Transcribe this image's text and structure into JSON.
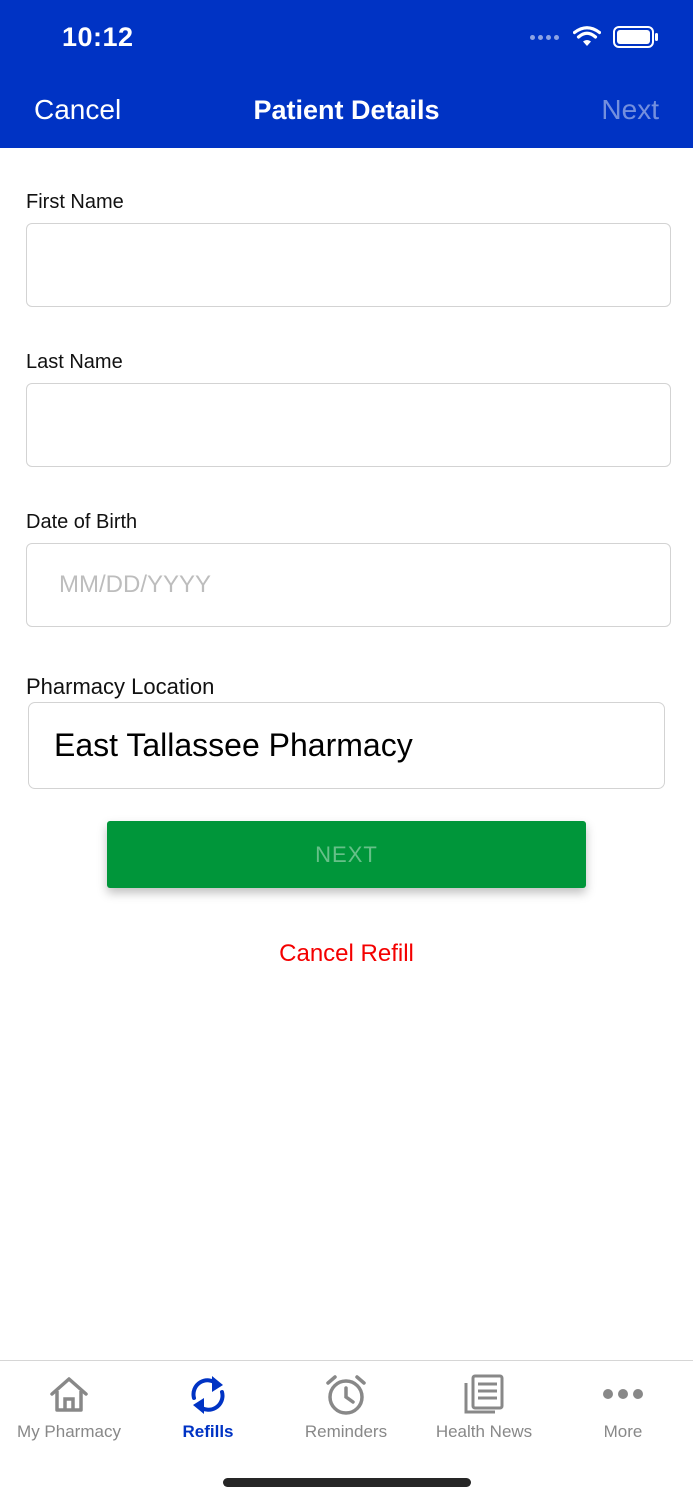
{
  "status_bar": {
    "time": "10:12"
  },
  "nav": {
    "cancel_label": "Cancel",
    "title": "Patient Details",
    "next_label": "Next"
  },
  "form": {
    "first_name": {
      "label": "First Name",
      "value": "",
      "placeholder": ""
    },
    "last_name": {
      "label": "Last Name",
      "value": "",
      "placeholder": ""
    },
    "dob": {
      "label": "Date of Birth",
      "value": "",
      "placeholder": "MM/DD/YYYY"
    },
    "pharmacy_location": {
      "label": "Pharmacy Location",
      "value": "East Tallassee Pharmacy"
    }
  },
  "actions": {
    "next_label": "NEXT",
    "cancel_refill_label": "Cancel Refill"
  },
  "tabs": [
    {
      "label": "My Pharmacy",
      "icon": "home-icon",
      "active": false
    },
    {
      "label": "Refills",
      "icon": "refresh-icon",
      "active": true
    },
    {
      "label": "Reminders",
      "icon": "alarm-clock-icon",
      "active": false
    },
    {
      "label": "Health News",
      "icon": "newspaper-icon",
      "active": false
    },
    {
      "label": "More",
      "icon": "more-dots-icon",
      "active": false
    }
  ],
  "colors": {
    "header_bg": "#0033c4",
    "accent": "#0033c4",
    "next_button": "#00963a",
    "cancel_refill": "#f40000",
    "tab_inactive": "#888888"
  }
}
